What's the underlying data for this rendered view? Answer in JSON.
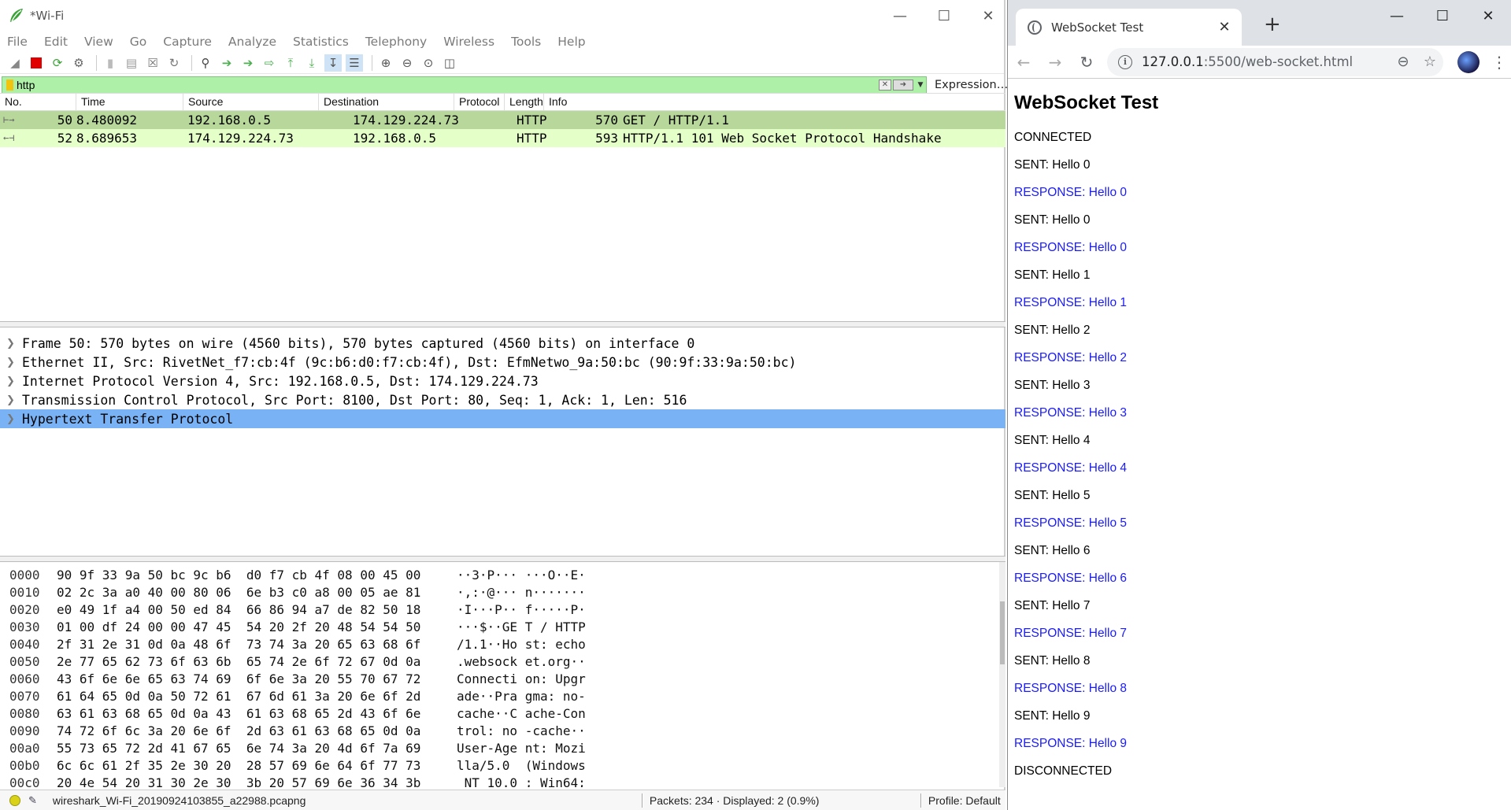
{
  "wireshark": {
    "title": "*Wi-Fi",
    "menu": [
      "File",
      "Edit",
      "View",
      "Go",
      "Capture",
      "Analyze",
      "Statistics",
      "Telephony",
      "Wireless",
      "Tools",
      "Help"
    ],
    "filter": {
      "value": "http",
      "expression_label": "Expression…"
    },
    "columns": [
      "No.",
      "Time",
      "Source",
      "Destination",
      "Protocol",
      "Length",
      "Info"
    ],
    "packets": [
      {
        "no": "50",
        "time": "8.480092",
        "src": "192.168.0.5",
        "dst": "174.129.224.73",
        "proto": "HTTP",
        "len": "570",
        "info": "GET / HTTP/1.1",
        "bg": "#b7d89a"
      },
      {
        "no": "52",
        "time": "8.689653",
        "src": "174.129.224.73",
        "dst": "192.168.0.5",
        "proto": "HTTP",
        "len": "593",
        "info": "HTTP/1.1 101 Web Socket Protocol Handshake",
        "bg": "#e4ffc7"
      }
    ],
    "details": [
      "Frame 50: 570 bytes on wire (4560 bits), 570 bytes captured (4560 bits) on interface 0",
      "Ethernet II, Src: RivetNet_f7:cb:4f (9c:b6:d0:f7:cb:4f), Dst: EfmNetwo_9a:50:bc (90:9f:33:9a:50:bc)",
      "Internet Protocol Version 4, Src: 192.168.0.5, Dst: 174.129.224.73",
      "Transmission Control Protocol, Src Port: 8100, Dst Port: 80, Seq: 1, Ack: 1, Len: 516",
      "Hypertext Transfer Protocol"
    ],
    "selected_detail_index": 4,
    "bytes": [
      {
        "off": "0000",
        "hex": "90 9f 33 9a 50 bc 9c b6  d0 f7 cb 4f 08 00 45 00",
        "asc": "··3·P··· ···O··E·"
      },
      {
        "off": "0010",
        "hex": "02 2c 3a a0 40 00 80 06  6e b3 c0 a8 00 05 ae 81",
        "asc": "·,:·@··· n·······"
      },
      {
        "off": "0020",
        "hex": "e0 49 1f a4 00 50 ed 84  66 86 94 a7 de 82 50 18",
        "asc": "·I···P·· f·····P·"
      },
      {
        "off": "0030",
        "hex": "01 00 df 24 00 00 47 45  54 20 2f 20 48 54 54 50",
        "asc": "···$··GE T / HTTP"
      },
      {
        "off": "0040",
        "hex": "2f 31 2e 31 0d 0a 48 6f  73 74 3a 20 65 63 68 6f",
        "asc": "/1.1··Ho st: echo"
      },
      {
        "off": "0050",
        "hex": "2e 77 65 62 73 6f 63 6b  65 74 2e 6f 72 67 0d 0a",
        "asc": ".websock et.org··"
      },
      {
        "off": "0060",
        "hex": "43 6f 6e 6e 65 63 74 69  6f 6e 3a 20 55 70 67 72",
        "asc": "Connecti on: Upgr"
      },
      {
        "off": "0070",
        "hex": "61 64 65 0d 0a 50 72 61  67 6d 61 3a 20 6e 6f 2d",
        "asc": "ade··Pra gma: no-"
      },
      {
        "off": "0080",
        "hex": "63 61 63 68 65 0d 0a 43  61 63 68 65 2d 43 6f 6e",
        "asc": "cache··C ache-Con"
      },
      {
        "off": "0090",
        "hex": "74 72 6f 6c 3a 20 6e 6f  2d 63 61 63 68 65 0d 0a",
        "asc": "trol: no -cache··"
      },
      {
        "off": "00a0",
        "hex": "55 73 65 72 2d 41 67 65  6e 74 3a 20 4d 6f 7a 69",
        "asc": "User-Age nt: Mozi"
      },
      {
        "off": "00b0",
        "hex": "6c 6c 61 2f 35 2e 30 20  28 57 69 6e 64 6f 77 73",
        "asc": "lla/5.0  (Windows"
      },
      {
        "off": "00c0",
        "hex": "20 4e 54 20 31 30 2e 30  3b 20 57 69 6e 36 34 3b",
        "asc": " NT 10.0 ; Win64;"
      }
    ],
    "status": {
      "file": "wireshark_Wi-Fi_20190924103855_a22988.pcapng",
      "packets": "Packets: 234 · Displayed: 2 (0.9%)",
      "profile": "Profile: Default"
    }
  },
  "chrome": {
    "tab_title": "WebSocket Test",
    "url_host": "127.0.0.1",
    "url_rest": ":5500/web-socket.html",
    "page_title": "WebSocket Test",
    "messages": [
      {
        "text": "CONNECTED",
        "type": "status"
      },
      {
        "text": "SENT: Hello 0",
        "type": "sent"
      },
      {
        "text": "RESPONSE: Hello 0",
        "type": "resp"
      },
      {
        "text": "SENT: Hello 0",
        "type": "sent"
      },
      {
        "text": "RESPONSE: Hello 0",
        "type": "resp"
      },
      {
        "text": "SENT: Hello 1",
        "type": "sent"
      },
      {
        "text": "RESPONSE: Hello 1",
        "type": "resp"
      },
      {
        "text": "SENT: Hello 2",
        "type": "sent"
      },
      {
        "text": "RESPONSE: Hello 2",
        "type": "resp"
      },
      {
        "text": "SENT: Hello 3",
        "type": "sent"
      },
      {
        "text": "RESPONSE: Hello 3",
        "type": "resp"
      },
      {
        "text": "SENT: Hello 4",
        "type": "sent"
      },
      {
        "text": "RESPONSE: Hello 4",
        "type": "resp"
      },
      {
        "text": "SENT: Hello 5",
        "type": "sent"
      },
      {
        "text": "RESPONSE: Hello 5",
        "type": "resp"
      },
      {
        "text": "SENT: Hello 6",
        "type": "sent"
      },
      {
        "text": "RESPONSE: Hello 6",
        "type": "resp"
      },
      {
        "text": "SENT: Hello 7",
        "type": "sent"
      },
      {
        "text": "RESPONSE: Hello 7",
        "type": "resp"
      },
      {
        "text": "SENT: Hello 8",
        "type": "sent"
      },
      {
        "text": "RESPONSE: Hello 8",
        "type": "resp"
      },
      {
        "text": "SENT: Hello 9",
        "type": "sent"
      },
      {
        "text": "RESPONSE: Hello 9",
        "type": "resp"
      },
      {
        "text": "DISCONNECTED",
        "type": "status"
      }
    ],
    "colors": {
      "response": "#1a1aff",
      "tabbar": "#dee1e6"
    }
  }
}
